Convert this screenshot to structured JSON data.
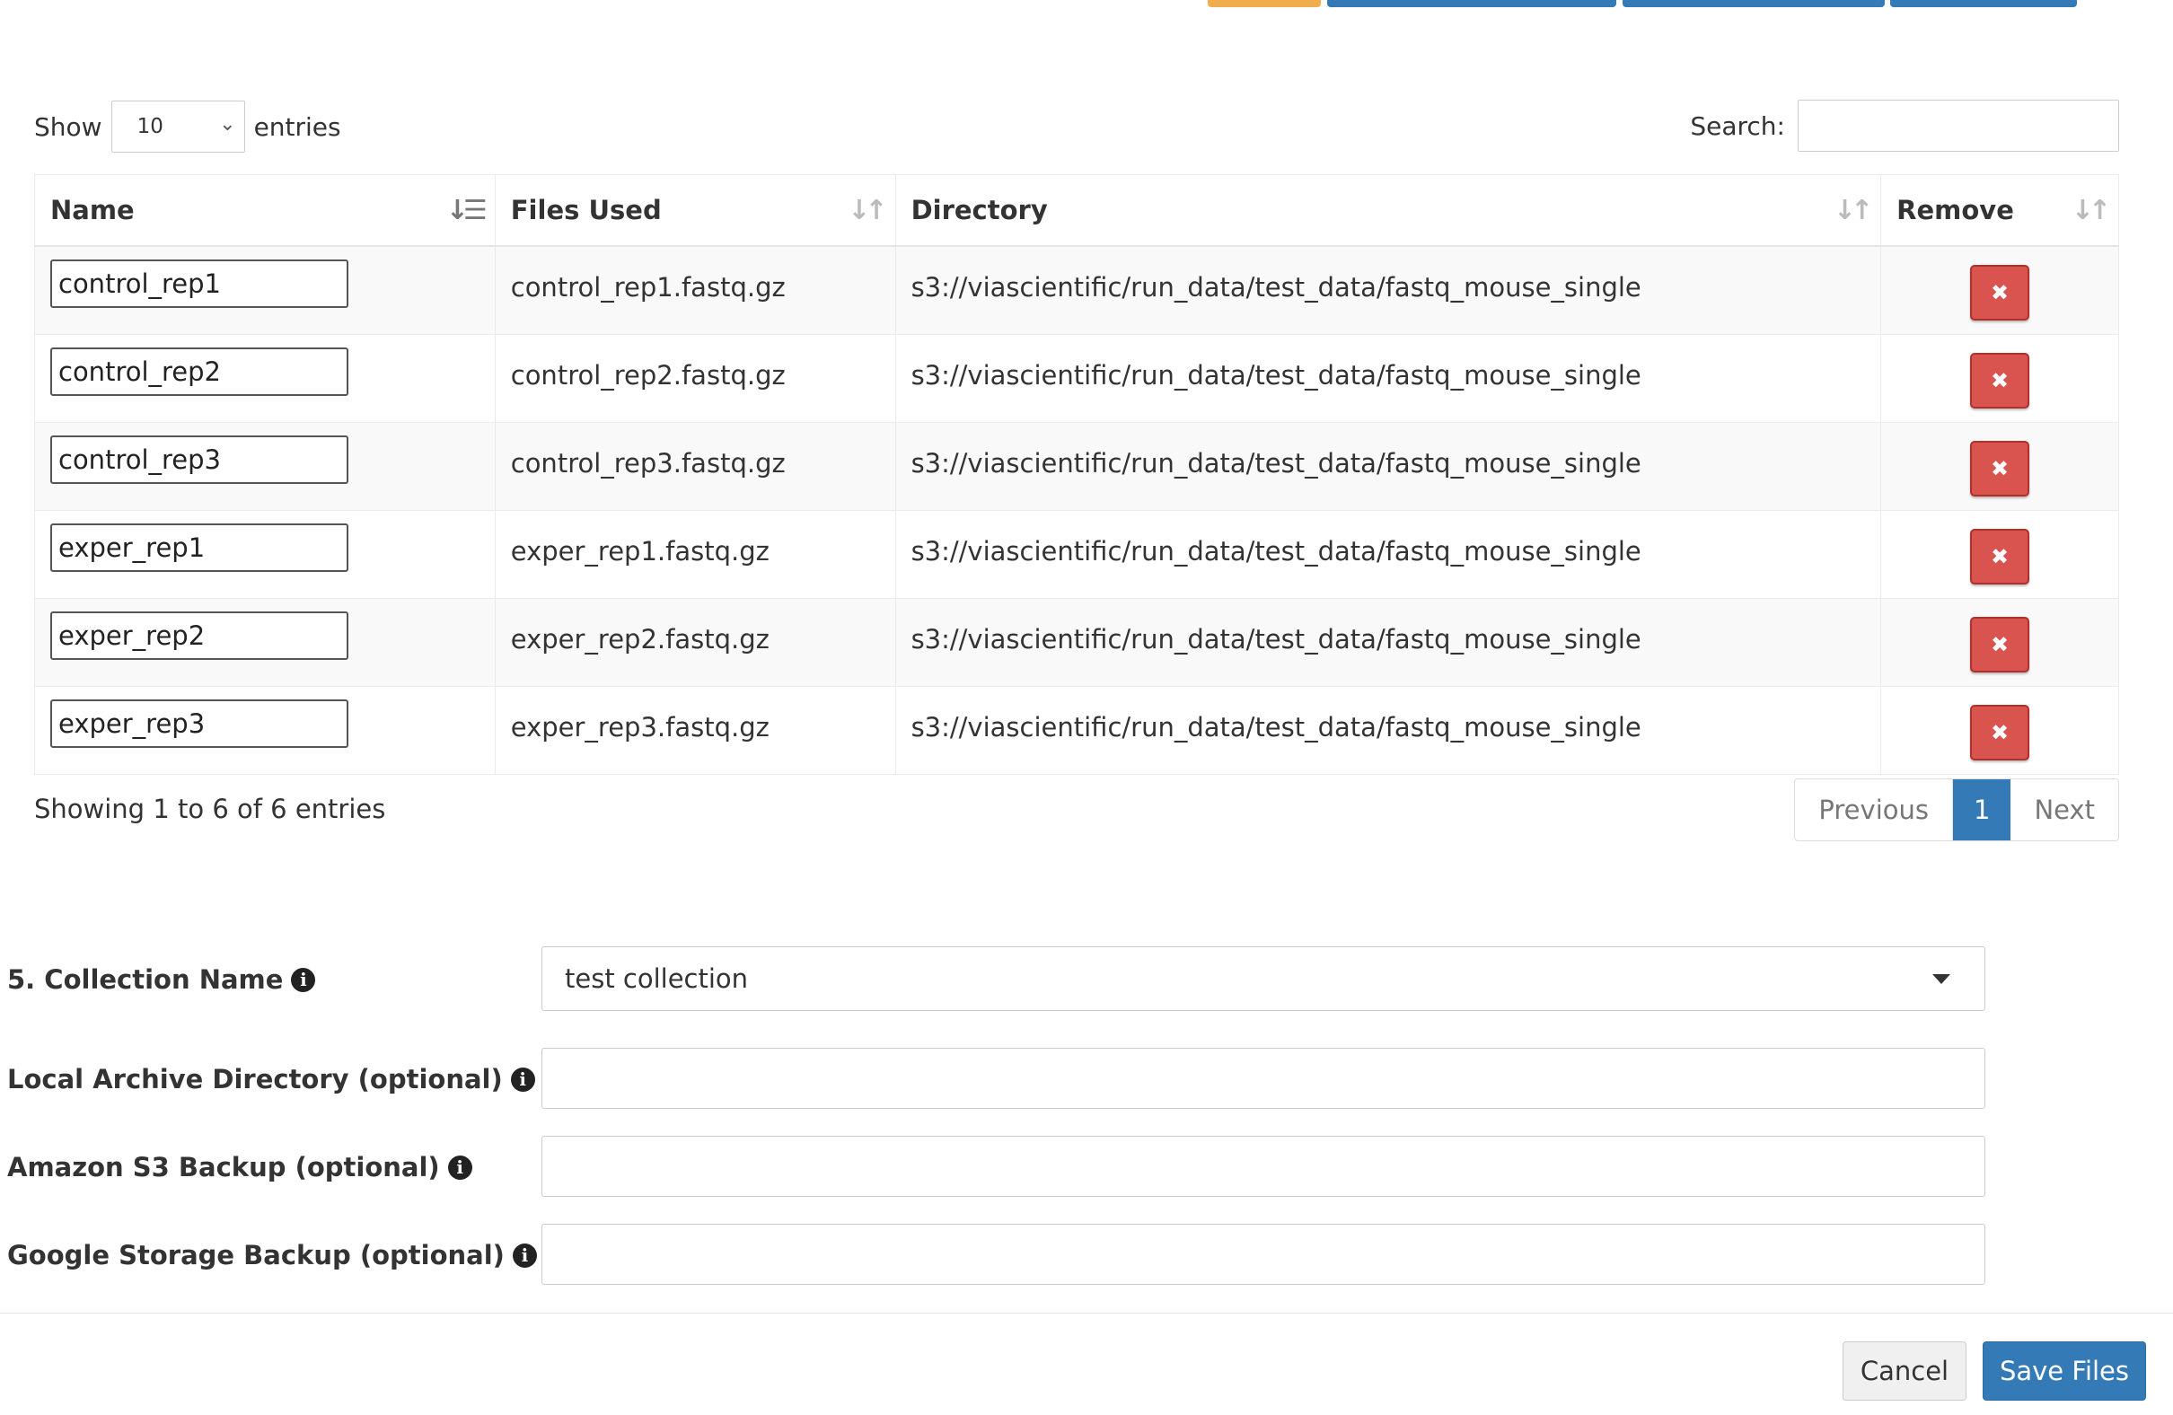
{
  "colors": {
    "primary": "#337ab7",
    "danger": "#d9534f",
    "warning": "#f0ad4e",
    "text": "#333333"
  },
  "length_menu": {
    "show_label": "Show",
    "selected": "10",
    "entries_label": "entries"
  },
  "search": {
    "label": "Search:",
    "value": ""
  },
  "table": {
    "columns": [
      "Name",
      "Files Used",
      "Directory",
      "Remove"
    ],
    "rows": [
      {
        "name": "control_rep1",
        "file": "control_rep1.fastq.gz",
        "directory": "s3://viascientific/run_data/test_data/fastq_mouse_single"
      },
      {
        "name": "control_rep2",
        "file": "control_rep2.fastq.gz",
        "directory": "s3://viascientific/run_data/test_data/fastq_mouse_single"
      },
      {
        "name": "control_rep3",
        "file": "control_rep3.fastq.gz",
        "directory": "s3://viascientific/run_data/test_data/fastq_mouse_single"
      },
      {
        "name": "exper_rep1",
        "file": "exper_rep1.fastq.gz",
        "directory": "s3://viascientific/run_data/test_data/fastq_mouse_single"
      },
      {
        "name": "exper_rep2",
        "file": "exper_rep2.fastq.gz",
        "directory": "s3://viascientific/run_data/test_data/fastq_mouse_single"
      },
      {
        "name": "exper_rep3",
        "file": "exper_rep3.fastq.gz",
        "directory": "s3://viascientific/run_data/test_data/fastq_mouse_single"
      }
    ],
    "remove_icon": "times-icon"
  },
  "info_text": "Showing 1 to 6 of 6 entries",
  "pagination": {
    "previous": "Previous",
    "current": "1",
    "next": "Next"
  },
  "form": {
    "collection_name": {
      "label": "5. Collection Name",
      "value": "test collection"
    },
    "local_archive": {
      "label": "Local Archive Directory (optional)",
      "value": ""
    },
    "s3_backup": {
      "label": "Amazon S3 Backup (optional)",
      "value": ""
    },
    "google_backup": {
      "label": "Google Storage Backup (optional)",
      "value": ""
    },
    "info_glyph": "i"
  },
  "footer": {
    "cancel": "Cancel",
    "save": "Save Files"
  }
}
